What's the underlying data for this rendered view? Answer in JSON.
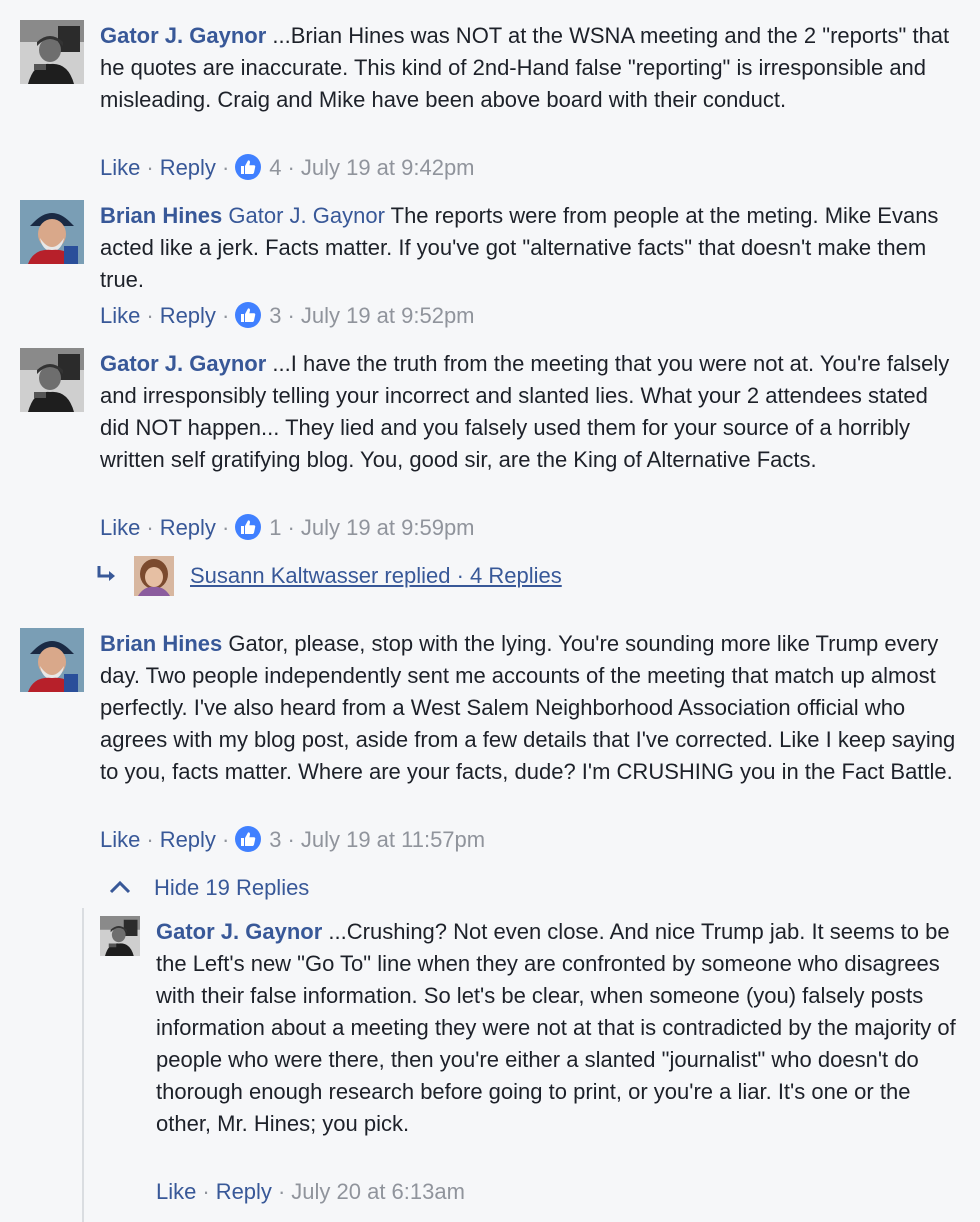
{
  "comments": [
    {
      "author": "Gator J. Gaynor",
      "mention": "",
      "text": "...Brian Hines was NOT at the WSNA meeting and the 2 \"reports\" that he quotes are inaccurate. This kind of 2nd-Hand false \"reporting\" is irresponsible and misleading. Craig and Mike have been above board with their conduct.",
      "like_label": "Like",
      "reply_label": "Reply",
      "likes": "4",
      "timestamp": "July 19 at 9:42pm"
    },
    {
      "author": "Brian Hines",
      "mention": "Gator J. Gaynor",
      "text": "The reports were from people at the meting. Mike Evans acted like a jerk. Facts matter. If you've got \"alternative facts\" that doesn't make them true.",
      "like_label": "Like",
      "reply_label": "Reply",
      "likes": "3",
      "timestamp": "July 19 at 9:52pm"
    },
    {
      "author": "Gator J. Gaynor",
      "mention": "",
      "text": "...I have the truth from the meeting that you were not at. You're falsely and irresponsibly telling your incorrect and slanted lies. What your 2 attendees stated did NOT happen... They lied and you falsely used them for your source of a horribly written self gratifying blog. You, good sir, are the King of Alternative Facts.",
      "like_label": "Like",
      "reply_label": "Reply",
      "likes": "1",
      "timestamp": "July 19 at 9:59pm"
    },
    {
      "author": "Brian Hines",
      "mention": "",
      "text": "Gator, please, stop with the lying. You're sounding more like Trump every day. Two people independently sent me accounts of the meeting that match up almost perfectly. I've also heard from a West Salem Neighborhood Association official who agrees with my blog post, aside from a few details that I've corrected. Like I keep saying to you, facts matter. Where are your facts, dude? I'm CRUSHING you in the Fact Battle.",
      "like_label": "Like",
      "reply_label": "Reply",
      "likes": "3",
      "timestamp": "July 19 at 11:57pm"
    }
  ],
  "replied": {
    "text": "Susann Kaltwasser replied · 4 Replies",
    "arrow_icon": "reply-arrow-icon"
  },
  "hide_replies": {
    "label": "Hide 19 Replies",
    "icon": "chevron-up-icon"
  },
  "nested_reply": {
    "author": "Gator J. Gaynor",
    "text": "...Crushing? Not even close. And nice Trump jab. It seems to be the Left's new \"Go To\" line when they are confronted by someone who disagrees with their false information. So let's be clear, when someone (you) falsely posts information about a meeting they were not at that is contradicted by the majority of people who were there, then you're either a slanted \"journalist\" who doesn't do thorough enough research before going to print, or you're a liar. It's one or the other, Mr. Hines; you pick.",
    "like_label": "Like",
    "reply_label": "Reply",
    "timestamp": "July 20 at 6:13am"
  },
  "separator": "·",
  "colors": {
    "link": "#385898",
    "meta": "#90949c",
    "like_badge": "#4080ff",
    "background": "#f6f7f9"
  }
}
